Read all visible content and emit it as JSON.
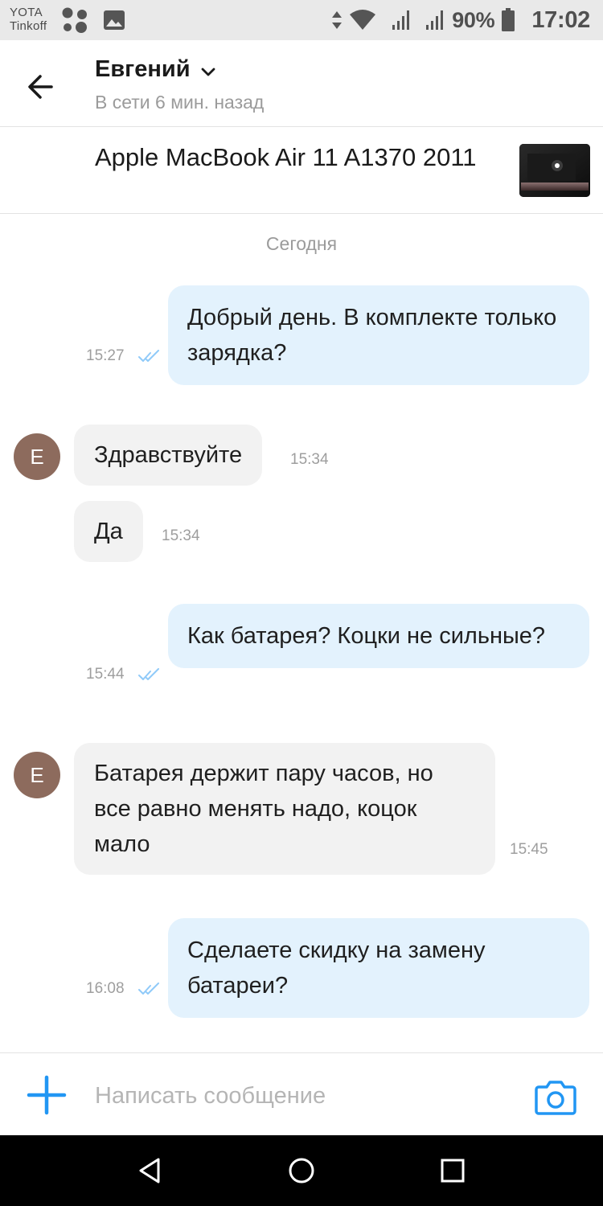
{
  "status_bar": {
    "carrier_line1": "YOTA",
    "carrier_line2": "Tinkoff",
    "battery_percent": "90%",
    "time": "17:02"
  },
  "header": {
    "contact_name": "Евгений",
    "contact_status": "В сети 6 мин. назад"
  },
  "listing": {
    "title": "Apple MacBook Air 11 A1370 2011"
  },
  "chat": {
    "date_label": "Сегодня",
    "avatar_letter": "Е",
    "messages": [
      {
        "direction": "outgoing",
        "text": "Добрый день. В комплекте только зарядка?",
        "time": "15:27",
        "read": true
      },
      {
        "direction": "incoming",
        "text": "Здравствуйте",
        "time": "15:34"
      },
      {
        "direction": "incoming",
        "text": "Да",
        "time": "15:34"
      },
      {
        "direction": "outgoing",
        "text": "Как батарея? Коцки не сильные?",
        "time": "15:44",
        "read": true
      },
      {
        "direction": "incoming",
        "text": "Батарея держит пару часов, но все равно менять надо, коцок мало",
        "time": "15:45"
      },
      {
        "direction": "outgoing",
        "text": "Сделаете скидку на замену батареи?",
        "time": "16:08",
        "read": true
      }
    ]
  },
  "composer": {
    "placeholder": "Написать сообщение",
    "value": ""
  },
  "colors": {
    "accent": "#2196f3",
    "outgoing_bubble": "#e3f2fd",
    "incoming_bubble": "#f2f2f2",
    "avatar": "#8d6b5d",
    "read_check": "#90caf9"
  },
  "icons": {
    "back": "arrow-left-icon",
    "dropdown": "chevron-down-icon",
    "add": "plus-icon",
    "camera": "camera-icon",
    "read": "double-check-icon",
    "nav_back": "triangle-back-icon",
    "nav_home": "circle-home-icon",
    "nav_recents": "square-recents-icon"
  }
}
